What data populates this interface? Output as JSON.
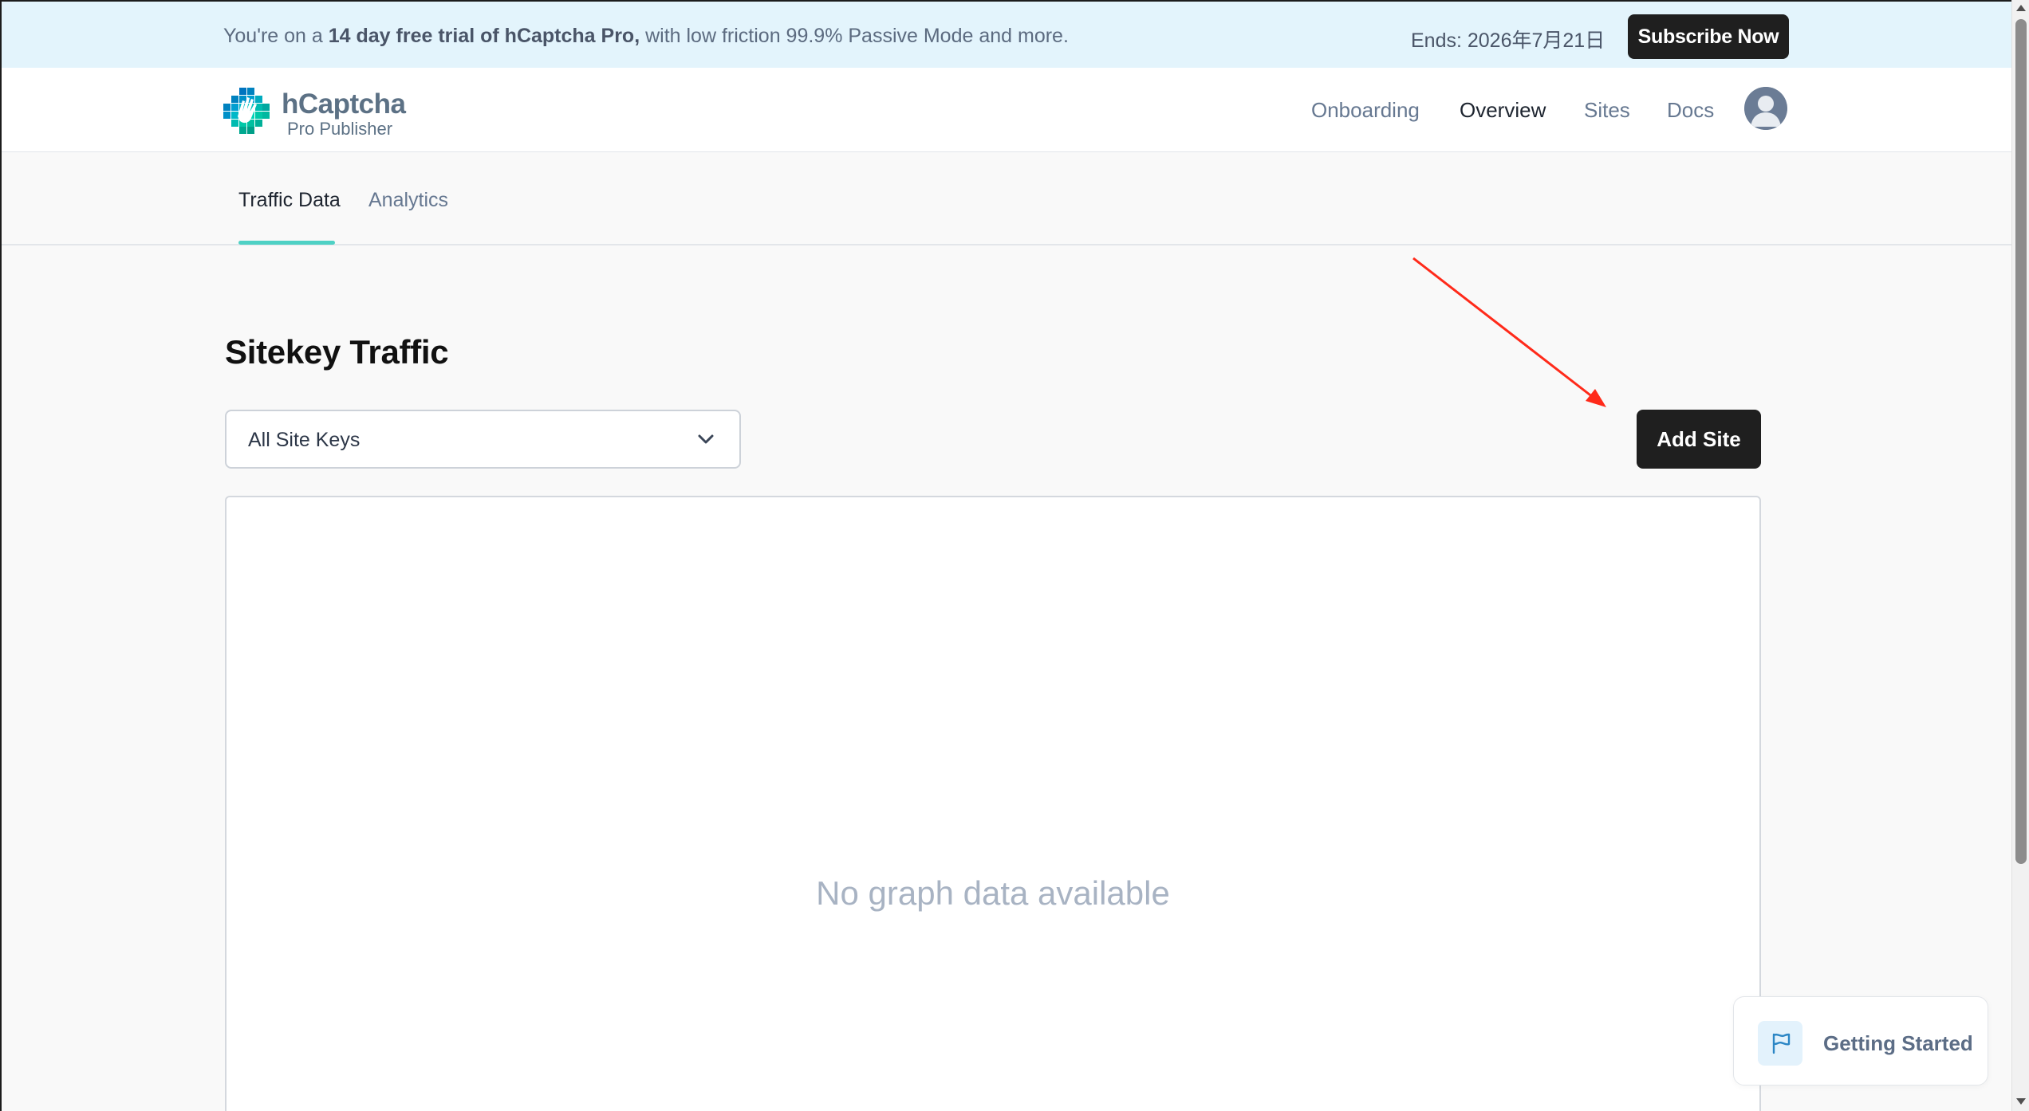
{
  "banner": {
    "prefix": "You're on a ",
    "highlight": "14 day free trial of hCaptcha Pro,",
    "suffix": " with low friction 99.9% Passive Mode and more.",
    "ends": "Ends: 2026年7月21日",
    "subscribe_label": "Subscribe Now"
  },
  "header": {
    "logo_name": "hCaptcha",
    "logo_sub": "Pro Publisher",
    "nav": {
      "onboarding": "Onboarding",
      "overview": "Overview",
      "sites": "Sites",
      "docs": "Docs"
    },
    "active_nav": "Overview"
  },
  "tabs": {
    "traffic_data": "Traffic Data",
    "analytics": "Analytics",
    "active": "Traffic Data"
  },
  "main": {
    "title": "Sitekey Traffic",
    "site_select_value": "All Site Keys",
    "add_site_label": "Add Site",
    "graph_empty_text": "No graph data available"
  },
  "getting_started": {
    "label": "Getting Started"
  },
  "colors": {
    "banner_bg": "#e3f4fc",
    "accent_teal": "#4fd1c5",
    "button_dark": "#1f1f1f",
    "annotation_arrow": "#ff2a1a"
  }
}
